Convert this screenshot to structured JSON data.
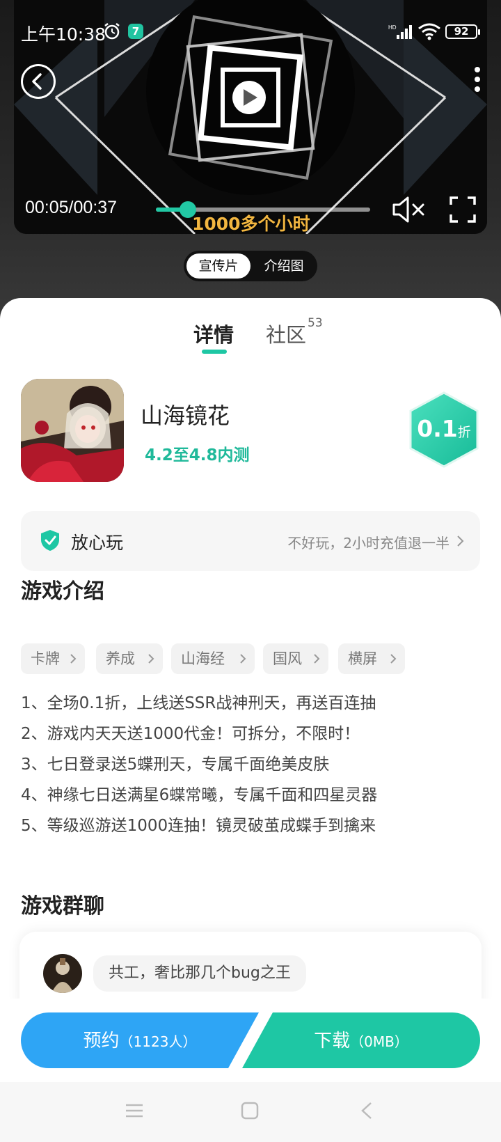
{
  "status_bar": {
    "time": "上午10:38",
    "notification_count": "7",
    "battery": "92"
  },
  "video": {
    "time": "00:05/00:37",
    "progress": 0.15,
    "subtitle": "1000多个小时",
    "tabs": [
      "宣传片",
      "介绍图"
    ],
    "active_tab": 0,
    "accent": "#22c8a4"
  },
  "detail_tabs": {
    "detail": "详情",
    "community": "社区",
    "community_count": "53"
  },
  "game": {
    "name": "山海镜花",
    "status": "4.2至4.8内测",
    "discount_value": "0.1",
    "discount_unit": "折"
  },
  "safe_play": {
    "title": "放心玩",
    "desc": "不好玩，2小时充值退一半"
  },
  "intro": {
    "title": "游戏介绍",
    "tags": [
      "卡牌",
      "养成",
      "山海经",
      "国风",
      "横屏"
    ],
    "lines": [
      "1、全场0.1折，上线送SSR战神刑天，再送百连抽",
      "2、游戏内天天送1000代金！可拆分，不限时！",
      "3、七日登录送5蝶刑天，专属千面绝美皮肤",
      "4、神缘七日送满星6蝶常曦，专属千面和四星灵器",
      "5、等级巡游送1000连抽！镜灵破茧成蝶手到擒来"
    ]
  },
  "group_chat": {
    "title": "游戏群聊",
    "message": "共工，奢比那几个bug之王"
  },
  "actions": {
    "reserve_label": "预约",
    "reserve_count": "（1123人）",
    "download_label": "下载",
    "download_size": "（0MB）",
    "reserve_color": "#2ea5f5",
    "download_color": "#1ec7a4"
  }
}
